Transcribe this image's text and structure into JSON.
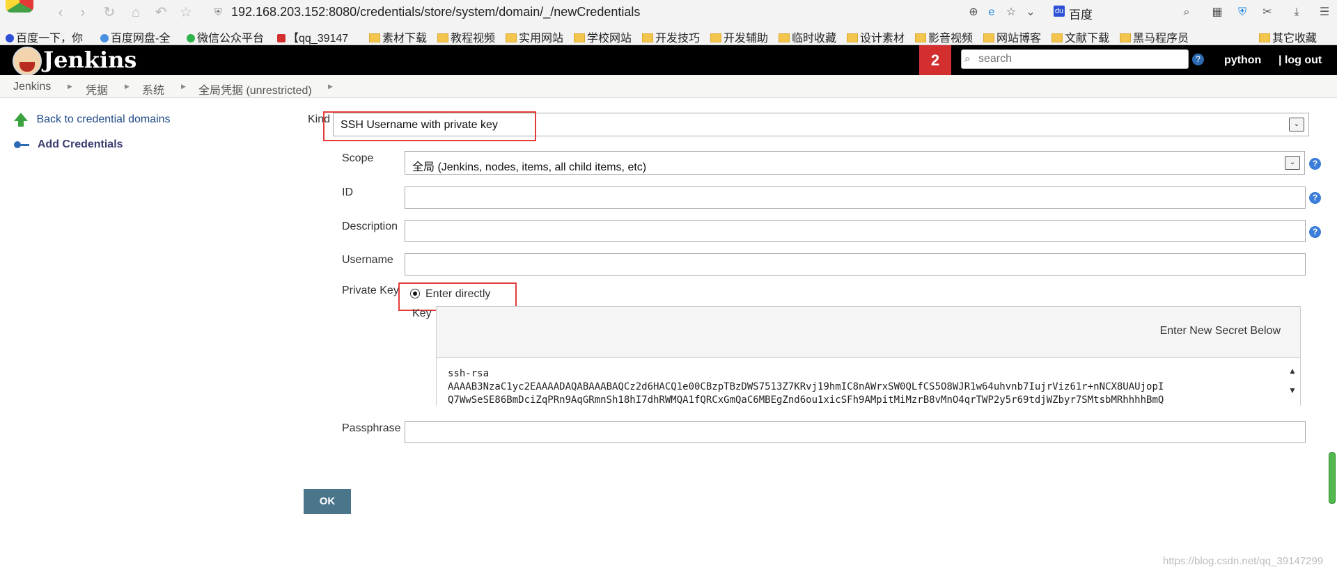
{
  "browser": {
    "url": "192.168.203.152:8080/credentials/store/system/domain/_/newCredentials",
    "search_engine_label": "百度",
    "bookmarks": [
      "百度一下，你",
      "百度网盘-全",
      "微信公众平台",
      "【qq_39147",
      "素材下载",
      "教程视频",
      "实用网站",
      "学校网站",
      "开发技巧",
      "开发辅助",
      "临时收藏",
      "设计素材",
      "影音视频",
      "网站博客",
      "文献下载",
      "黑马程序员",
      "其它收藏"
    ]
  },
  "header": {
    "app_title": "Jenkins",
    "notification_count": "2",
    "search_placeholder": "search",
    "user_name": "python",
    "logout_label": "| log out"
  },
  "breadcrumb": [
    "Jenkins",
    "凭据",
    "系统",
    "全局凭据 (unrestricted)"
  ],
  "sidebar": {
    "items": [
      {
        "label": "Back to credential domains"
      },
      {
        "label": "Add Credentials"
      }
    ]
  },
  "form": {
    "kind_label": "Kind",
    "kind_value": "SSH Username with private key",
    "scope_label": "Scope",
    "scope_value": "全局 (Jenkins, nodes, items, all child items, etc)",
    "id_label": "ID",
    "id_value": "",
    "description_label": "Description",
    "description_value": "",
    "username_label": "Username",
    "username_value": "",
    "private_key_label": "Private Key",
    "private_key_option": "Enter directly",
    "key_label": "Key",
    "key_hint": "Enter New Secret Below",
    "key_value": "ssh-rsa\nAAAAB3NzaC1yc2EAAAADAQABAAABAQCz2d6HACQ1e00CBzpTBzDWS7513Z7KRvj19hmIC8nAWrxSW0QLfCS5O8WJR1w64uhvnb7IujrViz61r+nNCX8UAUjopI\nQ7WwSeSE86BmDciZqPRn9AqGRmnSh18hI7dhRWMQA1fQRCxGmQaC6MBEgZnd6ou1xicSFh9AMpitMiMzrB8vMnO4qrTWP2y5r69tdjWZbyr7SMtsbMRhhhhBmQ",
    "passphrase_label": "Passphrase",
    "passphrase_value": "",
    "ok_label": "OK"
  },
  "watermark": "https://blog.csdn.net/qq_39147299",
  "colors": {
    "header_bg": "#000000",
    "badge_red": "#d32f2f",
    "ok_button": "#4b758b",
    "highlight": "#e33b3b",
    "link": "#204a87"
  }
}
